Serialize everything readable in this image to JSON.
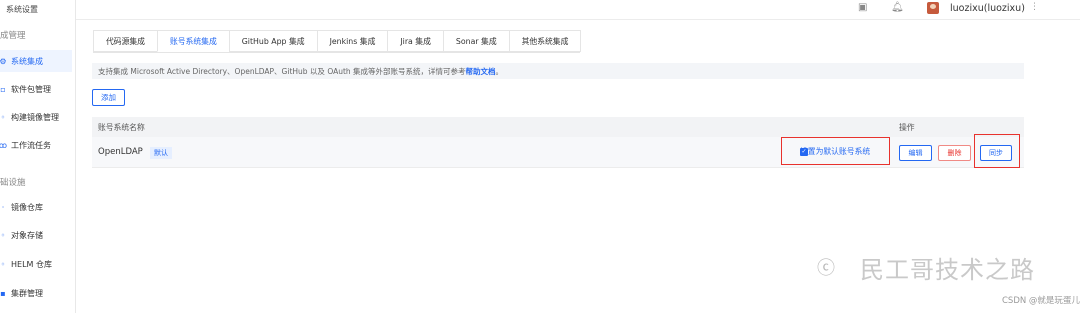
{
  "sidebar": {
    "title": "系统设置",
    "group1": "成管理",
    "items": [
      {
        "label": "系统集成",
        "icon": "integration-icon"
      },
      {
        "label": "软件包管理",
        "icon": "package-icon"
      },
      {
        "label": "构建镜像管理",
        "icon": "build-image-icon"
      },
      {
        "label": "工作流任务",
        "icon": "workflow-icon"
      }
    ],
    "group2": "础设施",
    "items2": [
      {
        "label": "镜像仓库",
        "icon": "image-repo-icon"
      },
      {
        "label": "对象存储",
        "icon": "object-storage-icon"
      },
      {
        "label": "HELM 仓库",
        "icon": "helm-icon"
      },
      {
        "label": "集群管理",
        "icon": "cluster-icon"
      }
    ]
  },
  "header": {
    "user": "luozixu(luozixu)"
  },
  "tabs": [
    {
      "label": "代码源集成"
    },
    {
      "label": "账号系统集成"
    },
    {
      "label": "GitHub App 集成"
    },
    {
      "label": "Jenkins 集成"
    },
    {
      "label": "Jira 集成"
    },
    {
      "label": "Sonar 集成"
    },
    {
      "label": "其他系统集成"
    }
  ],
  "info": {
    "text": "支持集成 Microsoft Active Directory、OpenLDAP、GitHub 以及 OAuth 集成等外部账号系统，详情可参考 ",
    "link": "帮助文档",
    "suffix": "。"
  },
  "add_button": "添加",
  "table": {
    "col_name": "账号系统名称",
    "col_action": "操作",
    "row": {
      "name": "OpenLDAP",
      "badge": "默认",
      "set_default": "设置为默认账号系统",
      "edit": "编辑",
      "delete": "删除",
      "sync": "同步"
    }
  },
  "watermark": {
    "text": "民工哥技术之路",
    "csdn": "CSDN @就是玩蛋儿"
  },
  "colors": {
    "accent": "#2468f2",
    "highlight": "#e8322d"
  }
}
